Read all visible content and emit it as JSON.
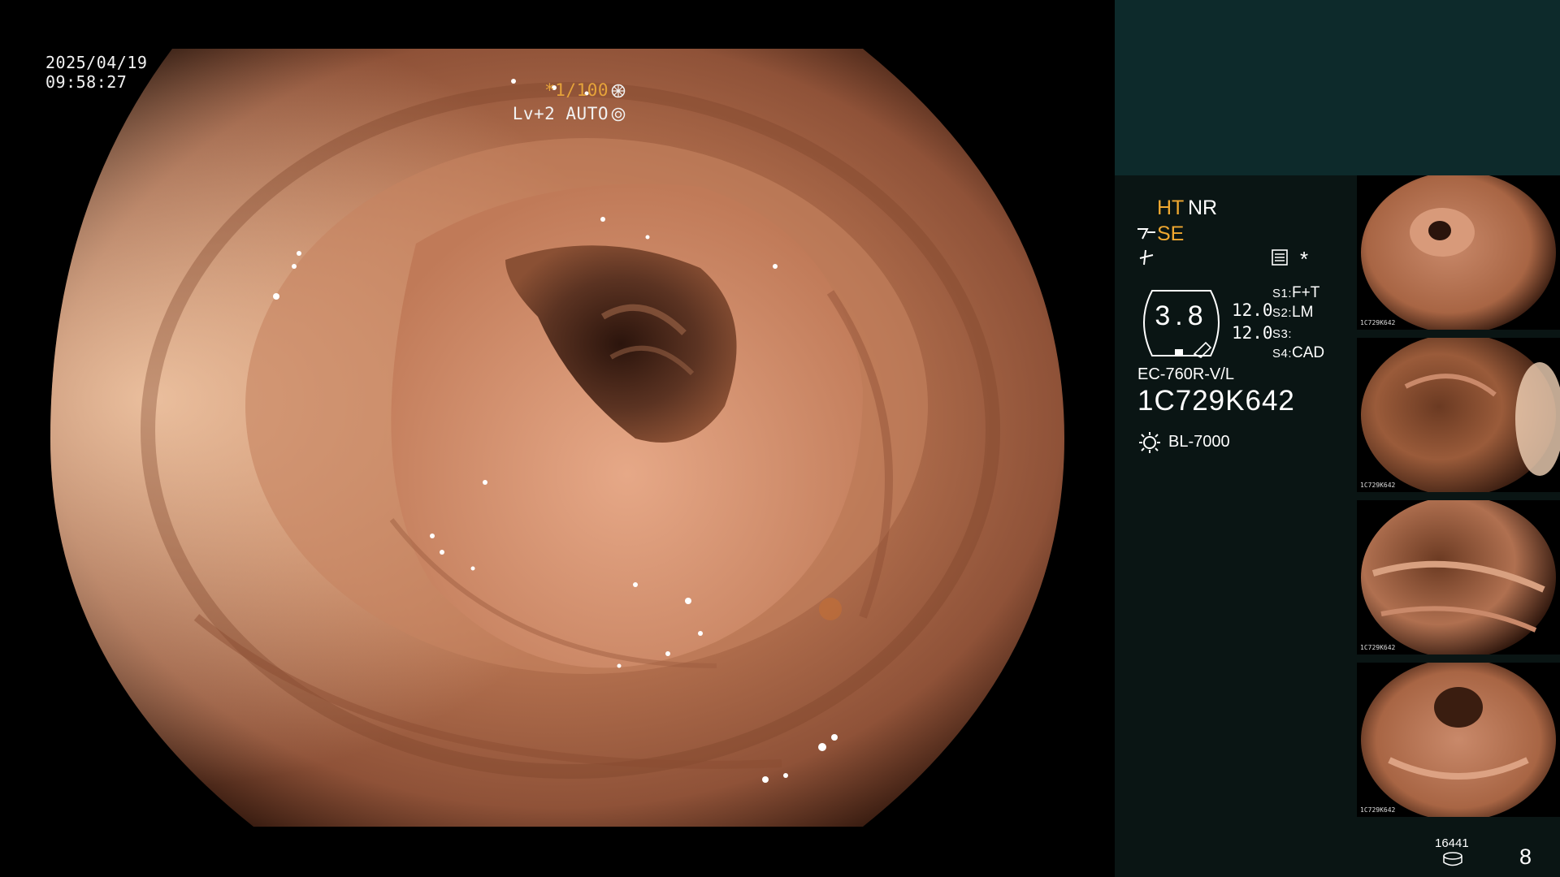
{
  "overlay": {
    "date": "2025/04/19",
    "time": "09:58:27",
    "shutter": "*1/100",
    "level": "Lv+2 AUTO"
  },
  "panel": {
    "ht": "HT",
    "nr": "NR",
    "se": "SE",
    "star": "*",
    "gauge_value": "3.8",
    "value_a": "12.0",
    "value_b": "12.0",
    "s_settings": [
      {
        "key": "S1:",
        "value": "F+T"
      },
      {
        "key": "S2:",
        "value": "LM"
      },
      {
        "key": "S3:",
        "value": ""
      },
      {
        "key": "S4:",
        "value": "CAD"
      }
    ],
    "scope_model": "EC-760R-V/L",
    "serial": "1C729K642",
    "light_source": "BL-7000",
    "bottom_count": "16441",
    "bottom_number": "8"
  },
  "thumbnails": [
    {
      "caption": "1C729K642"
    },
    {
      "caption": "1C729K642"
    },
    {
      "caption": "1C729K642"
    },
    {
      "caption": "1C729K642"
    }
  ],
  "icons": {
    "shutter": "aperture-icon",
    "level": "iris-icon",
    "structure": "structure-enhance-icon",
    "scope": "scope-icon",
    "memo": "memo-icon",
    "light": "light-source-icon",
    "disk": "storage-disk-icon"
  },
  "colors": {
    "accent_orange": "#f0a830",
    "panel_top": "#0d2a2b",
    "panel_bg": "#0a1514"
  }
}
